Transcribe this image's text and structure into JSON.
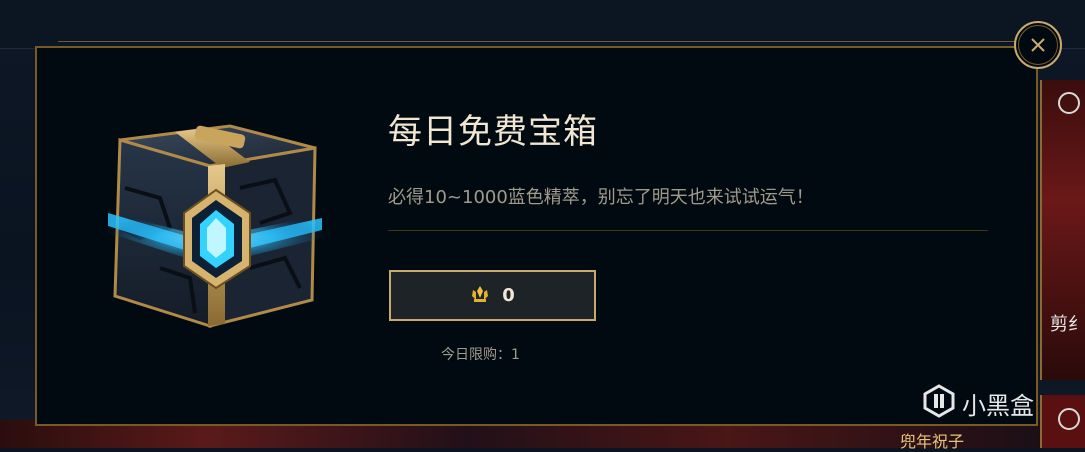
{
  "dialog": {
    "title": "每日免费宝箱",
    "description": "必得10~1000蓝色精萃，别忘了明天也来试试运气！",
    "chest_icon": "hextech-chest-icon",
    "buy_button": {
      "currency_icon": "blue-essence-icon",
      "count": "0"
    },
    "limit_text": "今日限购：1",
    "close_icon": "close-x-icon"
  },
  "background": {
    "right_card_text": "剪纟",
    "bottom_card_text": "兜年祝子",
    "clock_icon": "clock-icon"
  },
  "watermark": {
    "logo_icon": "xiaoheihe-logo-icon",
    "text": "小黑盒"
  },
  "colors": {
    "gold": "#c8aa6e",
    "dark_gold": "#785a28",
    "title_text": "#f0e6d2",
    "body_text": "#a09b8c",
    "panel_bg": "#010a10",
    "button_bg": "#1e2328"
  }
}
